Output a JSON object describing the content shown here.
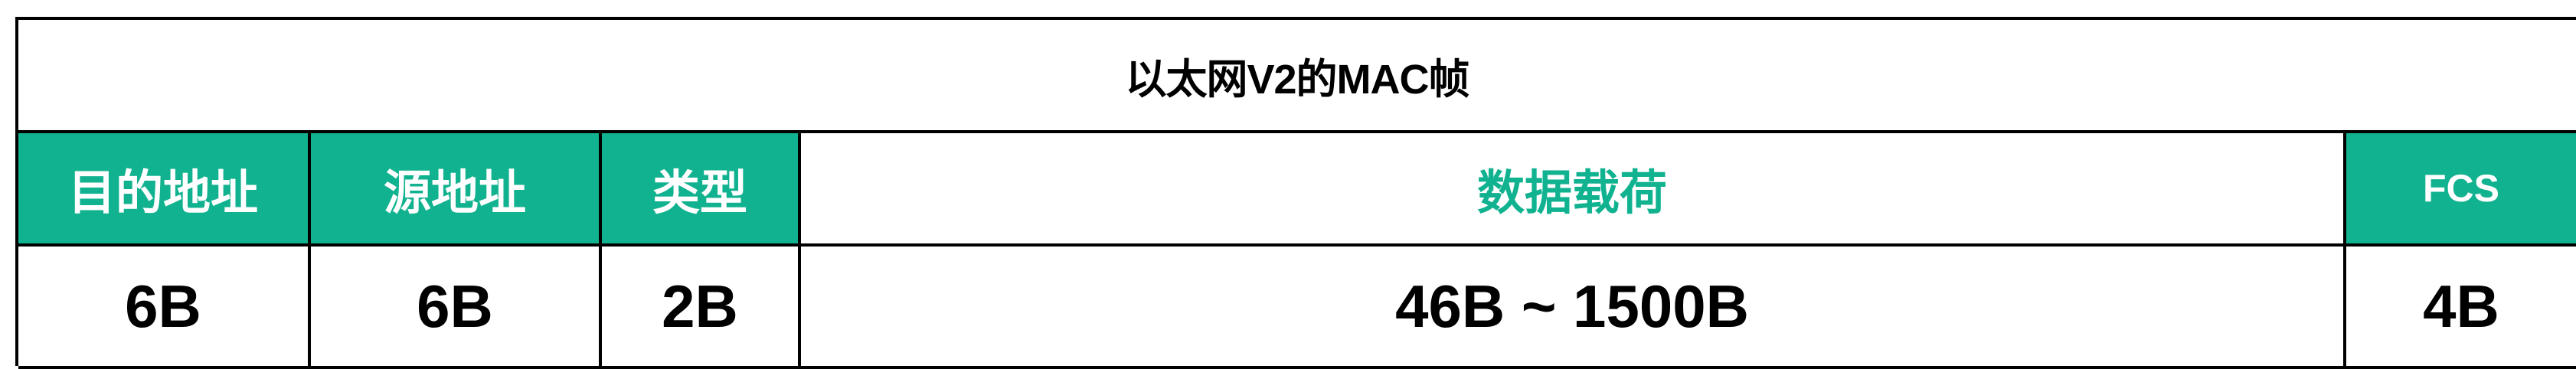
{
  "title": "以太网V2的MAC帧",
  "colors": {
    "accent": "#10b28f",
    "border": "#000000",
    "background": "#ffffff"
  },
  "fields": [
    {
      "label": "目的地址",
      "size": "6B"
    },
    {
      "label": "源地址",
      "size": "6B"
    },
    {
      "label": "类型",
      "size": "2B"
    },
    {
      "label": "数据载荷",
      "size": "46B ~ 1500B"
    },
    {
      "label": "FCS",
      "size": "4B"
    }
  ]
}
